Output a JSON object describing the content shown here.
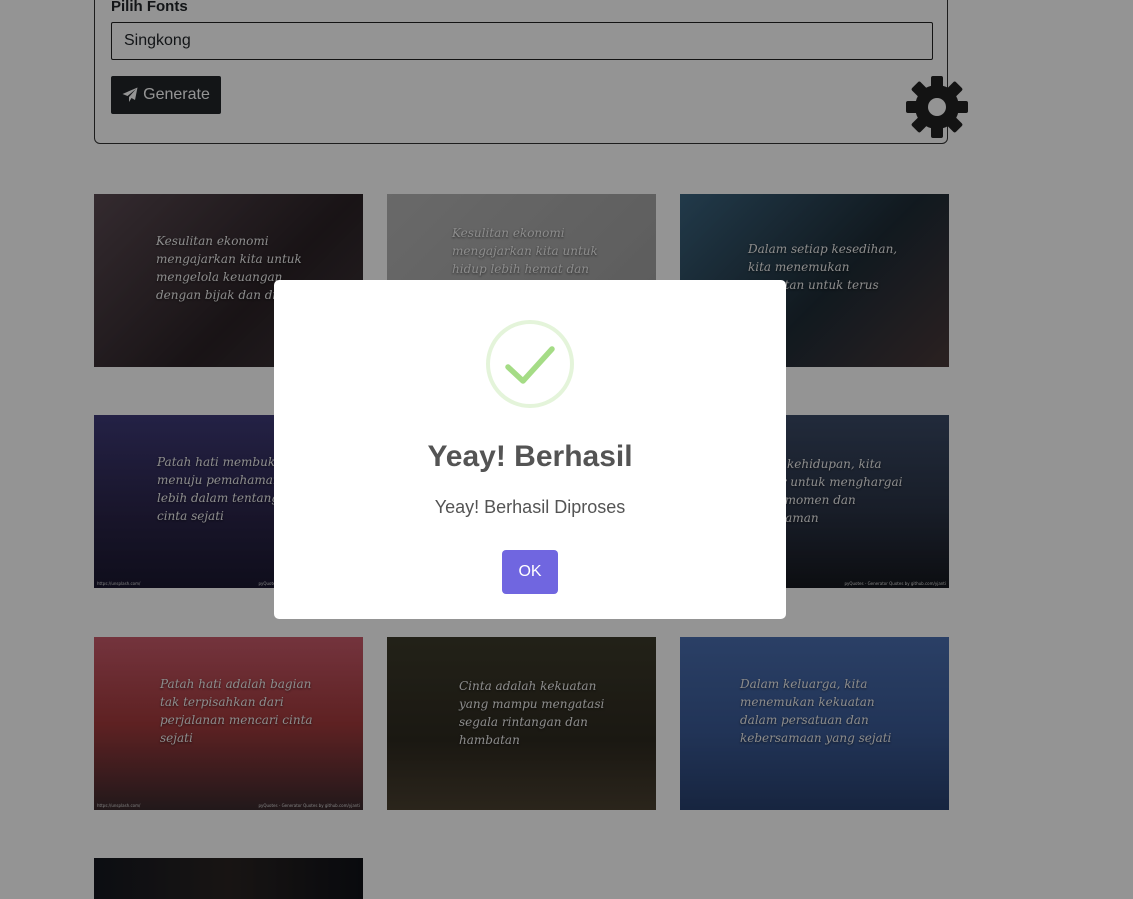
{
  "form": {
    "label": "Pilih Fonts",
    "selected_font": "Singkong",
    "generate_label": "Generate"
  },
  "gallery": [
    {
      "quote": "Kesulitan ekonomi mengajarkan kita untuk mengelola keuangan dengan bijak dan disiplin",
      "bg": "#3a2f35"
    },
    {
      "quote": "Kesulitan ekonomi mengajarkan kita untuk hidup lebih hemat dan",
      "bg": "#a4a4a4"
    },
    {
      "quote": "Dalam setiap kesedihan, kita menemukan kekuatan untuk terus maju",
      "bg": "#24353f"
    },
    {
      "quote": "Patah hati membuka jalan menuju pemahaman yang lebih dalam tentang arti cinta sejati",
      "bg": "#322c58"
    },
    {
      "quote": "",
      "bg": "#2e2e3c"
    },
    {
      "quote": "Dalam kehidupan, kita belajar untuk menghargai setiap momen dan pengalaman",
      "bg": "#2a3548"
    },
    {
      "quote": "Patah hati adalah bagian tak terpisahkan dari perjalanan mencari cinta sejati",
      "bg": "#a9404a"
    },
    {
      "quote": "Cinta adalah kekuatan yang mampu mengatasi segala rintangan dan hambatan",
      "bg": "#3a3324"
    },
    {
      "quote": "Dalam keluarga, kita menemukan kekuatan dalam persatuan dan kebersamaan yang sejati",
      "bg": "#3c5a90"
    },
    {
      "quote": "",
      "bg": "#1c1d25"
    }
  ],
  "tile_footer": {
    "left": "https://unsplash.com/",
    "right": "pyQuotes - Generator Quotes by github.com/yjanti"
  },
  "modal": {
    "title": "Yeay! Berhasil",
    "text": "Yeay! Berhasil Diproses",
    "ok_label": "OK"
  },
  "colors": {
    "overlay": "rgba(0,0,0,0.42)",
    "ok_button": "#7066e0",
    "success_green": "#a5dc86",
    "dark_button": "#212529"
  },
  "icons": {
    "generate": "paper-plane-icon",
    "settings": "gear-icon",
    "success": "checkmark-icon"
  }
}
